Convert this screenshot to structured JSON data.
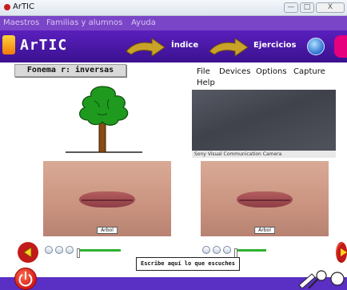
{
  "window": {
    "title": "ArTIC",
    "min": "—",
    "max": "□",
    "close": "X"
  },
  "menu": {
    "items": [
      "Maestros",
      "Familias y alumnos",
      "Ayuda"
    ]
  },
  "toolbar": {
    "app_name": "ArTIC",
    "index_label": "Índice",
    "exercises_label": "Ejercicios"
  },
  "main": {
    "phoneme_label": "Fonema r: inversas",
    "capture_menu": {
      "items": [
        "File",
        "Devices",
        "Options",
        "Capture",
        "Help"
      ]
    },
    "camera_caption": "Sony Visual Communication Camera",
    "left_video_caption": "Árbol",
    "right_video_caption": "Árbol",
    "answer_prompt": "Escribe aquí lo que escuches"
  },
  "colors": {
    "toolbar": "#4a17a8",
    "menubar": "#7a45c7",
    "accent": "#2fb12f",
    "button_red": "#d21a1a"
  },
  "icons": [
    "tree-picture",
    "back-arrow-icon",
    "next-arrow-icon",
    "globe-icon",
    "power-icon",
    "tools-icon"
  ]
}
